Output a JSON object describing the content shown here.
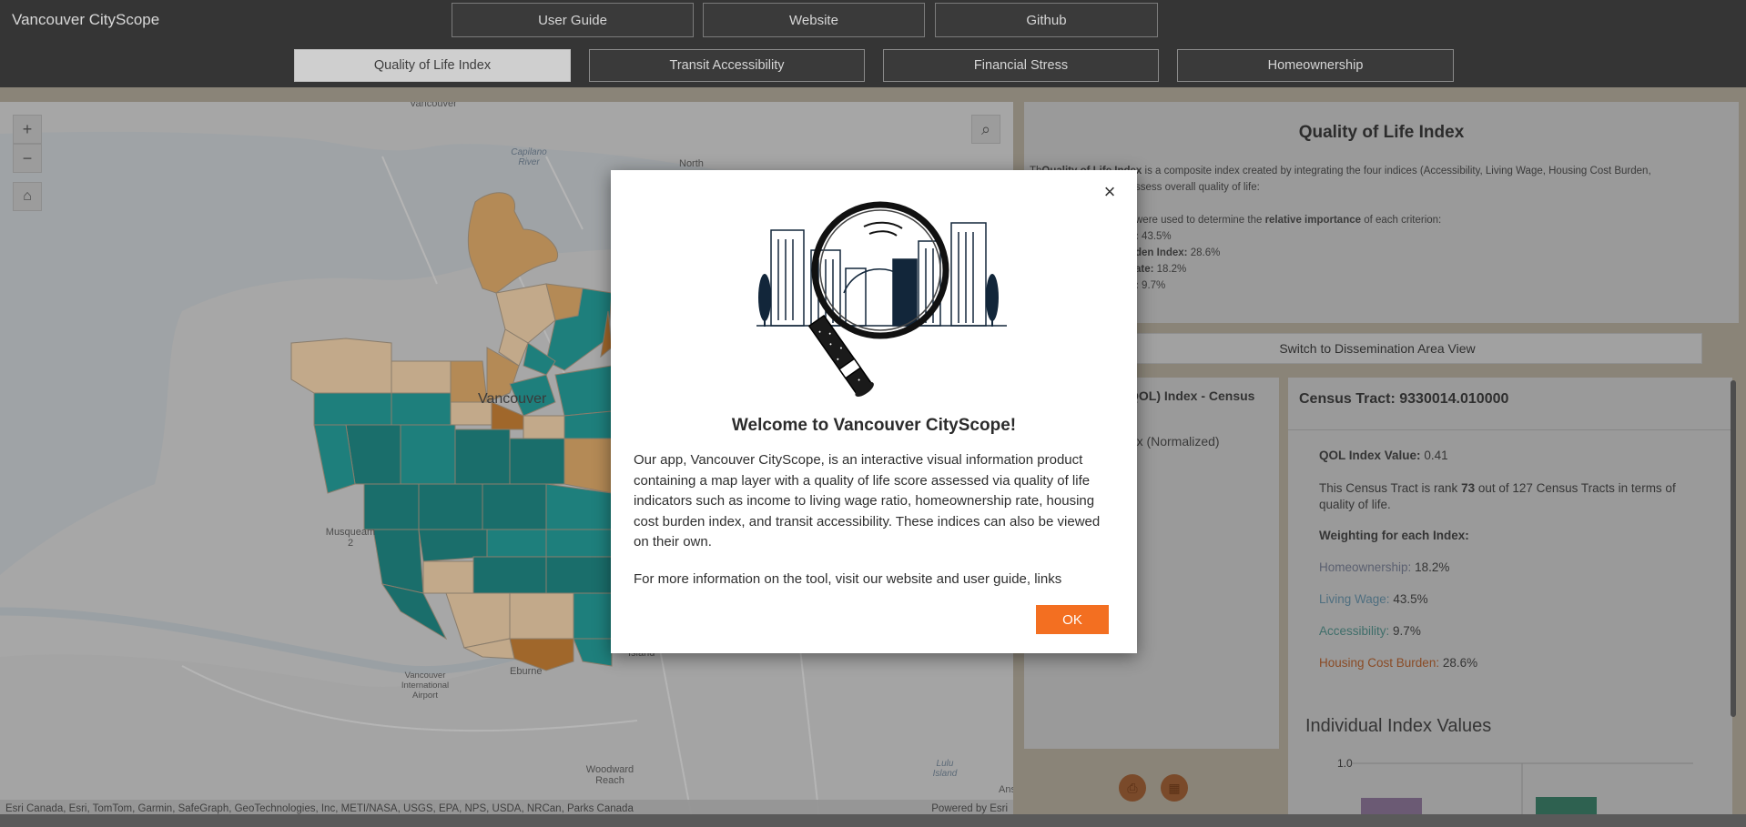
{
  "app": {
    "title": "Vancouver CityScope"
  },
  "top_links": [
    {
      "label": "User Guide"
    },
    {
      "label": "Website"
    },
    {
      "label": "Github"
    }
  ],
  "tabs": [
    {
      "label": "Quality of Life Index",
      "active": true
    },
    {
      "label": "Transit Accessibility",
      "active": false
    },
    {
      "label": "Financial Stress",
      "active": false
    },
    {
      "label": "Homeownership",
      "active": false
    }
  ],
  "map": {
    "controls": {
      "zoom_in": "+",
      "zoom_out": "−",
      "home": "⌂",
      "search": "⌕"
    },
    "labels": {
      "vancouver_top": "Vancouver",
      "north": "North",
      "capilano": "Capilano River",
      "vancouver_city": "Vancouver",
      "musqueam": "Musqueam 2",
      "eburne": "Eburne",
      "airport": "Vancouver International Airport",
      "woodward": "Woodward Reach",
      "lulu": "Lulu Island",
      "island": "Island",
      "ans": "Ans"
    },
    "attribution": "Esri Canada, Esri, TomTom, Garmin, SafeGraph, GeoTechnologies, Inc, METI/NASA, USGS, EPA, NPS, USDA, NRCan, Parks Canada",
    "powered_by": "Powered by Esri"
  },
  "info": {
    "title": "Quality of Life Index",
    "line1_prefix": "Th",
    "line1_bold": "Quality of Life Index",
    "line1_rest": " is a composite index created by integrating the four indices (Accessibility, Living Wage, Housing Cost Burden,",
    "line2": "ssess overall quality of life:",
    "line3_prefix": "were used to determine the ",
    "line3_bold": "relative importance",
    "line3_rest": " of each criterion:",
    "weights": [
      {
        "bold": ":",
        "value": "43.5%"
      },
      {
        "bold": "den Index:",
        "value": "28.6%"
      },
      {
        "bold": "ate:",
        "value": "18.2%"
      },
      {
        "bold": ":",
        "value": "9.7%"
      }
    ]
  },
  "switch_button": "Switch to Dissemination Area View",
  "legend": {
    "title_fragment": "QOL) Index - Census",
    "subtitle_fragment": "dex (Normalized)"
  },
  "tract": {
    "heading": "Census Tract: 9330014.010000",
    "qol_label": "QOL Index Value:",
    "qol_value": "0.41",
    "rank_prefix": "This Census Tract is rank ",
    "rank": "73",
    "rank_suffix": " out of 127 Census Tracts in terms of",
    "rank_line2": "quality of life.",
    "weighting_label": "Weighting for each Index:",
    "weights": [
      {
        "label": "Homeownership:",
        "value": "18.2%"
      },
      {
        "label": "Living Wage:",
        "value": "43.5%"
      },
      {
        "label": "Accessibility:",
        "value": "9.7%"
      },
      {
        "label": "Housing Cost Burden:",
        "value": "28.6%"
      }
    ],
    "chart_title": "Individual Index Values",
    "chart_tick": "1.0"
  },
  "modal": {
    "title": "Welcome to Vancouver CityScope!",
    "paragraph1": "Our app, Vancouver CityScope, is an interactive visual information product containing a map layer with a quality of life score assessed via quality of life indicators such as income to living wage ratio, homeownership rate, housing cost burden index, and transit accessibility. These indices can also be viewed on their own.",
    "paragraph2": "For more information on the tool, visit our website and user guide, links",
    "close": "×",
    "ok": "OK"
  },
  "colors": {
    "accent_orange": "#f36f21",
    "teal": "#1e7f7c",
    "tan": "#c2a889",
    "brown": "#a0672b"
  }
}
